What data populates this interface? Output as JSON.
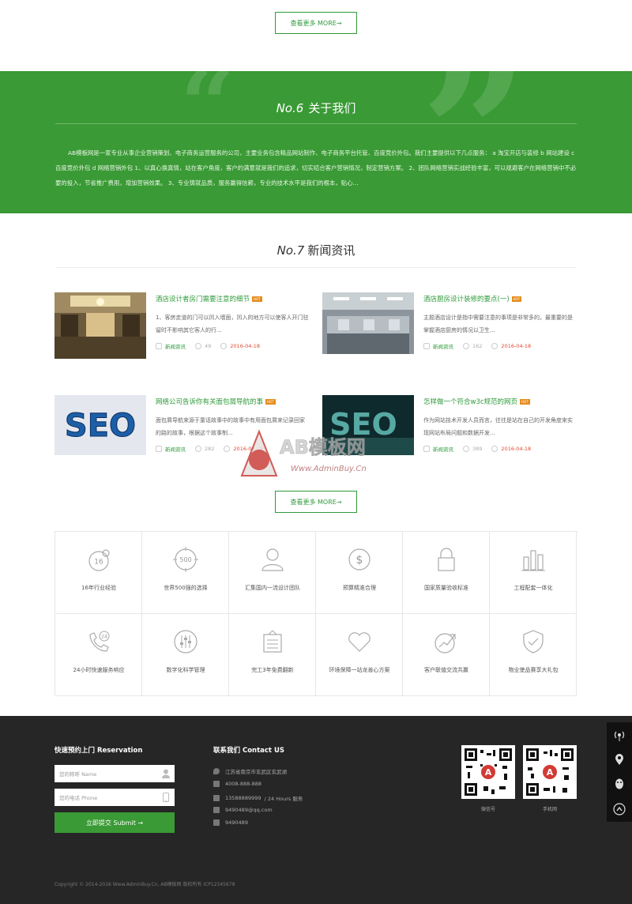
{
  "more_label": "查看更多 MORE→",
  "about": {
    "no": "No.6",
    "title": "关于我们",
    "text": "AB模板网是一家专业从事企业营销策划、电子商务运营服务的公司，主要业务包含精品网站制作、电子商务平台托管、百度竞价外包。我们主要提供以下几点服务： a 淘宝开店与装修 b 网站建设 c 百度竞价外包 d 网络营销外包 1、以真心换真情，站在客户角度，客户的满意就是我们的追求，切实结合客户营销情况，制定营销方案。 2、团队网络营销实战经验丰富，可以规避客户在网络营销中不必要的投入，节省推广费用，增加营销效果。 3、专业铸就品质，服务赢得信赖，专业的技术水平是我们的根本，贴心..."
  },
  "news": {
    "no": "No.7",
    "title": "新闻资讯",
    "hot": "HOT",
    "items": [
      {
        "title": "酒店设计者房门需要注意的细节",
        "desc": "1、客房走道的门可以凹入墙面，凹入的地方可以使客人开门驻留时不影响其它客人的行...",
        "category": "新闻资讯",
        "views": "49",
        "date": "2016-04-18"
      },
      {
        "title": "酒店厨房设计装修的要点(一)",
        "desc": "主题酒店设计是指中需要注意的事项是非常多的。最重要的是掌握酒店厨房的情况以卫生...",
        "category": "新闻资讯",
        "views": "162",
        "date": "2016-04-18"
      },
      {
        "title": "网络公司告诉你有关面包屑导航的事",
        "desc": "面包屑导航来源于童话故事中的故事中有用面包屑来记录回家的路的故事，根据这个故事制...",
        "category": "新闻资讯",
        "views": "282",
        "date": "2016-04-18"
      },
      {
        "title": "怎样做一个符合w3c规范的网页",
        "desc": "作为网站技术开发人员而言，往往是站在自己的开发角度来实 现网站布局问题和数据开发...",
        "category": "新闻资讯",
        "views": "389",
        "date": "2016-04-18"
      }
    ]
  },
  "watermark": {
    "brand": "AB模板网",
    "url": "Www.AdminBuy.Cn"
  },
  "features": [
    {
      "label": "16年行业经验",
      "icon": "badge-16-icon",
      "num": "16"
    },
    {
      "label": "世界500强的选择",
      "icon": "target-500-icon",
      "num": "500"
    },
    {
      "label": "汇集国内一流设计团队",
      "icon": "person-icon"
    },
    {
      "label": "预算精准合理",
      "icon": "dollar-coin-icon"
    },
    {
      "label": "国家质量验收标准",
      "icon": "lock-icon"
    },
    {
      "label": "工程配套一体化",
      "icon": "bar-chart-icon"
    },
    {
      "label": "24小时快速服务响应",
      "icon": "phone-24-icon",
      "num": "24"
    },
    {
      "label": "数字化科学管理",
      "icon": "sliders-icon"
    },
    {
      "label": "完工3年免费翻新",
      "icon": "document-icon"
    },
    {
      "label": "环境保障一站龙善心方案",
      "icon": "heart-icon"
    },
    {
      "label": "客户联值交流共赢",
      "icon": "growth-arrow-icon"
    },
    {
      "label": "物业使品赛享大礼包",
      "icon": "shield-check-icon"
    }
  ],
  "footer": {
    "reservation_title": "快速预约上门 Reservation",
    "name_placeholder": "您的称呼 Name",
    "phone_placeholder": "您的电话 Phone",
    "submit": "立即提交 Submit →",
    "contact_title": "联系我们 Contact US",
    "address": "江苏省南京市玄武区玄武湖",
    "tel": "4008-888-888",
    "mobile": "13588889999",
    "hours": "/ 24 Hours 服务",
    "email": "9490489@qq.com",
    "qq": "9490489",
    "qr1_label": "微信号",
    "qr2_label": "手机网",
    "copyright": "Copyright © 2014-2016 Www.AdminBuy.Cn, AB模板网 版权所有 ICP12345678"
  },
  "colors": {
    "green": "#3a9a35",
    "dark": "#262626",
    "hot": "#e58c1e",
    "date": "#e04a2f"
  }
}
